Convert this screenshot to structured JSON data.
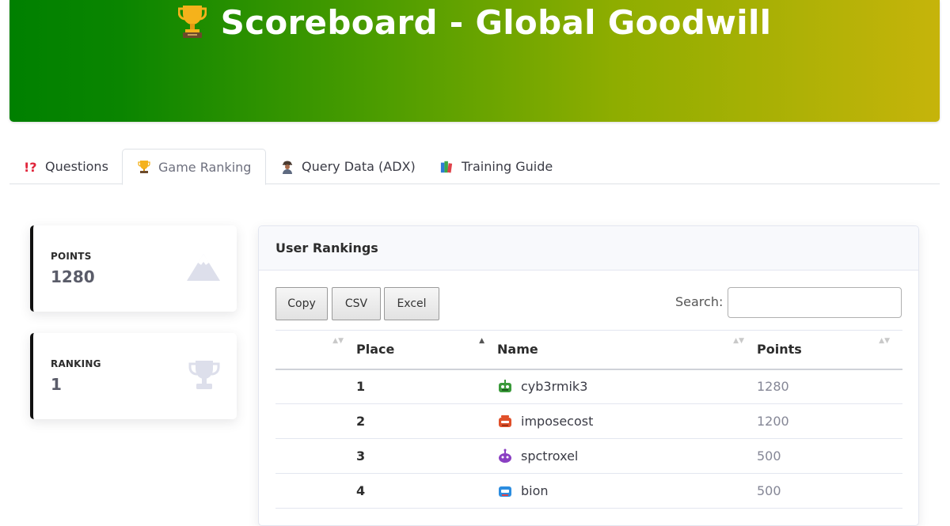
{
  "header": {
    "title": "Scoreboard - Global Goodwill",
    "icon": "trophy-icon",
    "gradient": [
      "#008000",
      "#c6b40a"
    ]
  },
  "tabs": [
    {
      "label": "Questions",
      "icon": "interrobang-icon"
    },
    {
      "label": "Game Ranking",
      "icon": "trophy-icon",
      "active": true
    },
    {
      "label": "Query Data (ADX)",
      "icon": "detective-icon"
    },
    {
      "label": "Training Guide",
      "icon": "books-icon"
    }
  ],
  "stats": {
    "points": {
      "label": "POINTS",
      "value": "1280",
      "icon": "mountain-icon"
    },
    "ranking": {
      "label": "RANKING",
      "value": "1",
      "icon": "trophy-outline-icon"
    }
  },
  "rankings": {
    "title": "User Rankings",
    "buttons": {
      "copy": "Copy",
      "csv": "CSV",
      "excel": "Excel"
    },
    "search": {
      "label": "Search:",
      "value": "",
      "placeholder": ""
    },
    "columns": {
      "blank": "",
      "place": "Place",
      "name": "Name",
      "points": "Points"
    },
    "rows": [
      {
        "place": "1",
        "name": "cyb3rmik3",
        "points": "1280",
        "avatar": "green-robot-icon",
        "avatar_color": "#3a9a3a"
      },
      {
        "place": "2",
        "name": "imposecost",
        "points": "1200",
        "avatar": "red-robot-icon",
        "avatar_color": "#e0502a"
      },
      {
        "place": "3",
        "name": "spctroxel",
        "points": "500",
        "avatar": "purple-robot-icon",
        "avatar_color": "#8a3fc2"
      },
      {
        "place": "4",
        "name": "bion",
        "points": "500",
        "avatar": "blue-robot-icon",
        "avatar_color": "#2c8de0"
      }
    ]
  }
}
